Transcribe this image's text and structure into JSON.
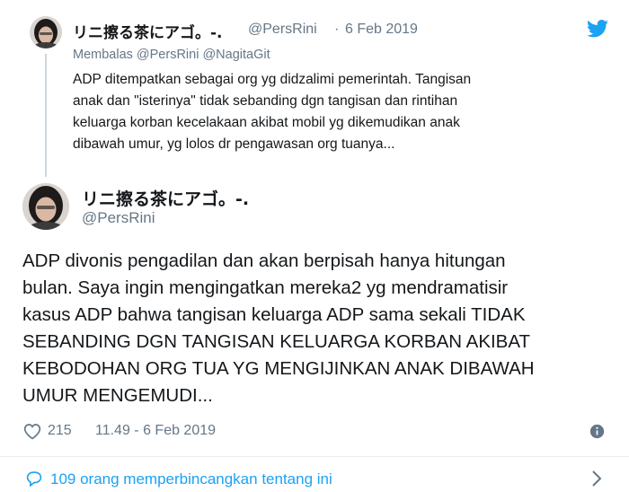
{
  "reply": {
    "display_name": "リニ擦る茶にアゴ。-.",
    "handle": "@PersRini",
    "separator": "·",
    "date": "6 Feb 2019",
    "replying_to": "Membalas @PersRini @NagitaGit",
    "text_lines": [
      "ADP ditempatkan sebagai org yg didzalimi pemerintah. Tangisan",
      "anak dan \"isterinya\" tidak sebanding dgn tangisan dan rintihan",
      "keluarga korban kecelakaan akibat mobil yg dikemudikan anak",
      "dibawah umur, yg lolos dr pengawasan org tuanya..."
    ]
  },
  "main": {
    "display_name": "リニ擦る茶にアゴ。-.",
    "handle": "@PersRini",
    "text_lines": [
      "ADP divonis pengadilan dan akan berpisah hanya hitungan",
      "bulan. Saya ingin mengingatkan mereka2 yg mendramatisir",
      "kasus ADP bahwa tangisan keluarga ADP sama sekali TIDAK",
      "SEBANDING DGN TANGISAN KELUARGA KORBAN AKIBAT",
      "KEBODOHAN ORG TUA YG MENGIJINKAN ANAK DIBAWAH",
      "UMUR MENGEMUDI..."
    ],
    "likes": "215",
    "timestamp": "11.49 - 6 Feb 2019"
  },
  "conversation": {
    "text": "109 orang memperbincangkan tentang ini"
  },
  "icons": {
    "brand": "twitter-bird-icon",
    "like": "heart-icon",
    "info": "info-icon",
    "conversation": "speech-bubble-icon",
    "chevron": "chevron-right-icon"
  },
  "colors": {
    "brand_blue": "#1da1f2",
    "text": "#14171a",
    "muted": "#657786",
    "thread_line": "#ccd6dd"
  }
}
